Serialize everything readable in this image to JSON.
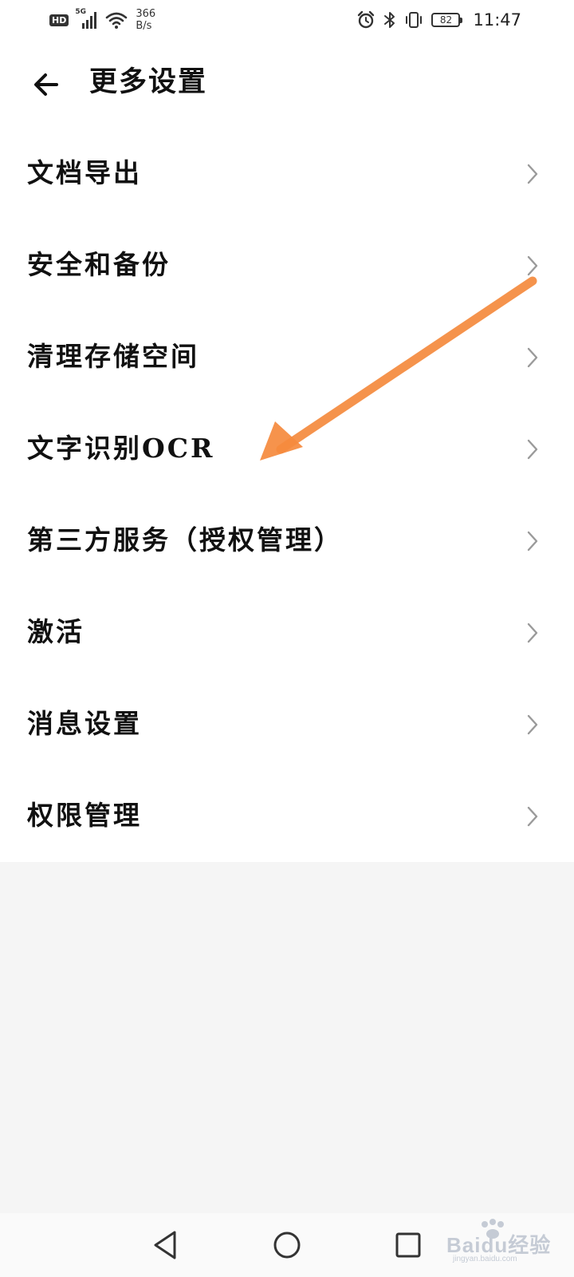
{
  "status_bar": {
    "hd_label": "HD",
    "network_type": "5G",
    "net_speed_value": "366",
    "net_speed_unit": "B/s",
    "battery_level": "82",
    "time": "11:47",
    "icons": [
      "hd-icon",
      "signal-icon",
      "wifi-icon",
      "alarm-icon",
      "bluetooth-icon",
      "vibrate-icon",
      "battery-icon"
    ]
  },
  "header": {
    "title": "更多设置",
    "back_icon": "arrow-left-icon"
  },
  "settings": {
    "items": [
      {
        "label": "文档导出"
      },
      {
        "label": "安全和备份"
      },
      {
        "label": "清理存储空间"
      },
      {
        "label": "文字识别OCR"
      },
      {
        "label": "第三方服务（授权管理）"
      },
      {
        "label": "激活"
      },
      {
        "label": "消息设置"
      },
      {
        "label": "权限管理"
      }
    ],
    "chevron_icon": "chevron-right-icon"
  },
  "annotation": {
    "arrow_color": "#f58a3d",
    "points_to": "文字识别OCR"
  },
  "nav_bar": {
    "icons": [
      "nav-back-icon",
      "nav-home-icon",
      "nav-recents-icon"
    ]
  },
  "watermark": {
    "text": "Baidu经验",
    "sub": "jingyan.baidu.com"
  }
}
